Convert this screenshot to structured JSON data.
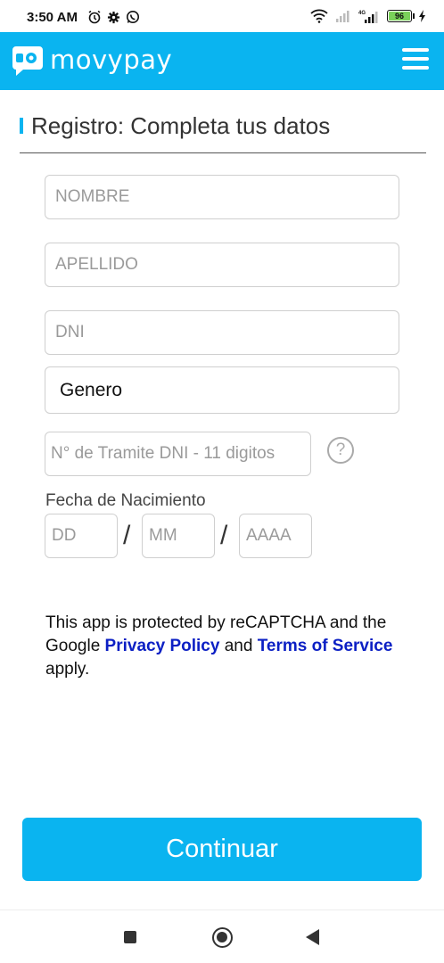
{
  "status_bar": {
    "time": "3:50 AM",
    "battery": "96",
    "icons": [
      "alarm-icon",
      "settings-icon",
      "whatsapp-icon",
      "wifi-icon",
      "signal-icon",
      "4g-signal-icon",
      "battery-icon",
      "charging-icon"
    ]
  },
  "header": {
    "brand": "movypay",
    "brand_color": "#0ab4f0"
  },
  "page": {
    "title": "Registro: Completa tus datos"
  },
  "form": {
    "nombre_placeholder": "NOMBRE",
    "apellido_placeholder": "APELLIDO",
    "dni_placeholder": "DNI",
    "genero_value": "Genero",
    "tramite_placeholder": "N° de Tramite DNI - 11 digitos",
    "help_glyph": "?",
    "dob_label": "Fecha de Nacimiento",
    "dd_placeholder": "DD",
    "mm_placeholder": "MM",
    "aaaa_placeholder": "AAAA",
    "separator": "/"
  },
  "recaptcha": {
    "text_before": "This app is protected by reCAPTCHA and the Google ",
    "privacy_link": "Privacy Policy",
    "text_middle": " and ",
    "terms_link": "Terms of Service",
    "text_after": " apply.",
    "link_color": "#0b1fc4"
  },
  "actions": {
    "continue_label": "Continuar"
  }
}
